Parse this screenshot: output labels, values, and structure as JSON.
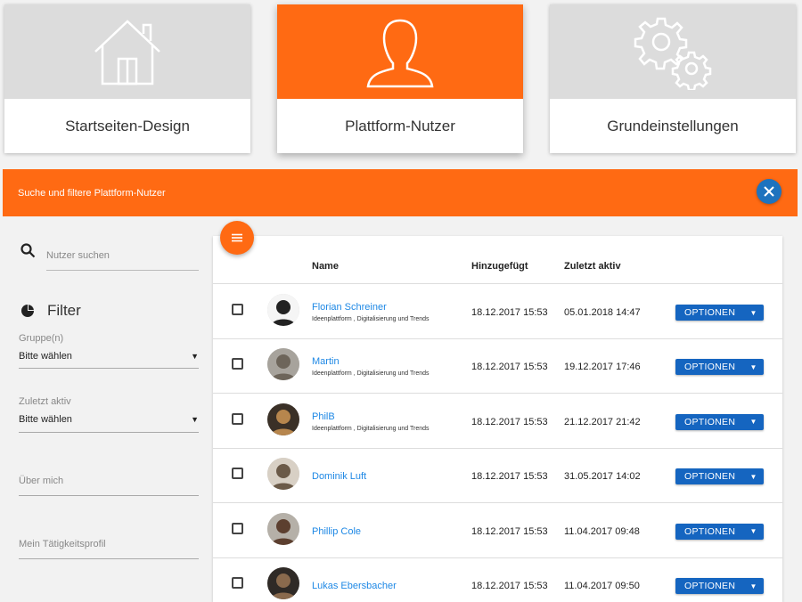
{
  "tiles": [
    {
      "label": "Startseiten-Design",
      "icon": "house-icon"
    },
    {
      "label": "Plattform-Nutzer",
      "icon": "user-silhouette-icon",
      "active": true
    },
    {
      "label": "Grundeinstellungen",
      "icon": "gears-icon"
    }
  ],
  "search_bar": {
    "title": "Suche und filtere Plattform-Nutzer"
  },
  "sidebar": {
    "search_placeholder": "Nutzer suchen",
    "filter_title": "Filter",
    "fields": {
      "gruppe": {
        "label": "Gruppe(n)",
        "value": "Bitte wählen"
      },
      "zuletzt": {
        "label": "Zuletzt aktiv",
        "value": "Bitte wählen"
      },
      "ueber": {
        "label": "Über mich"
      },
      "taetig": {
        "label": "Mein Tätigkeitsprofil"
      }
    }
  },
  "table": {
    "headers": {
      "name": "Name",
      "added": "Hinzugefügt",
      "active": "Zuletzt aktiv"
    },
    "option_label": "OPTIONEN",
    "rows": [
      {
        "name": "Florian Schreiner",
        "groups": "Ideenplattform , Digitalisierung und Trends",
        "added": "18.12.2017 15:53",
        "last_active": "05.01.2018 14:47"
      },
      {
        "name": "Martin",
        "groups": "Ideenplattform , Digitalisierung und Trends",
        "added": "18.12.2017 15:53",
        "last_active": "19.12.2017 17:46"
      },
      {
        "name": "PhilB",
        "groups": "Ideenplattform , Digitalisierung und Trends",
        "added": "18.12.2017 15:53",
        "last_active": "21.12.2017 21:42"
      },
      {
        "name": "Dominik Luft",
        "groups": "",
        "added": "18.12.2017 15:53",
        "last_active": "31.05.2017 14:02"
      },
      {
        "name": "Phillip Cole",
        "groups": "",
        "added": "18.12.2017 15:53",
        "last_active": "11.04.2017 09:48"
      },
      {
        "name": "Lukas Ebersbacher",
        "groups": "",
        "added": "18.12.2017 15:53",
        "last_active": "11.04.2017 09:50"
      }
    ]
  },
  "colors": {
    "accent": "#ff6a13",
    "primary": "#1565c0",
    "link": "#1e88e5"
  }
}
